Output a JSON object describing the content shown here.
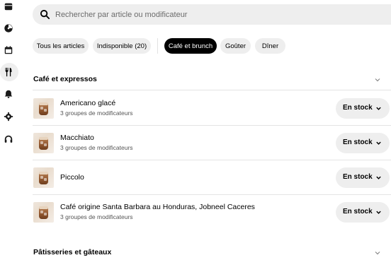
{
  "sidebar": {
    "icons": [
      "store-icon",
      "dashboard-icon",
      "calendar-icon",
      "menu-fork-knife-icon",
      "bell-icon",
      "gear-icon",
      "headset-icon"
    ],
    "active": "menu-fork-knife-icon"
  },
  "search": {
    "placeholder": "Rechercher par article ou modificateur"
  },
  "filters": [
    {
      "label": "Tous les articles",
      "active": false
    },
    {
      "label": "Indisponible (20)",
      "active": false
    },
    {
      "label": "Café et brunch",
      "active": true
    },
    {
      "label": "Goûter",
      "active": false
    },
    {
      "label": "Dîner",
      "active": false
    }
  ],
  "sections": [
    {
      "title": "Café et expressos",
      "items": [
        {
          "name": "Americano glacé",
          "modifiers": "3 groupes de modificateurs",
          "status": "En stock"
        },
        {
          "name": "Macchiato",
          "modifiers": "3 groupes de modificateurs",
          "status": "En stock"
        },
        {
          "name": "Piccolo",
          "modifiers": "",
          "status": "En stock"
        },
        {
          "name": "Café origine Santa Barbara au Honduras, Jobneel Caceres",
          "modifiers": "3 groupes de modificateurs",
          "status": "En stock"
        }
      ]
    },
    {
      "title": "Pâtisseries et gâteaux",
      "items": []
    }
  ],
  "colors": {
    "accent": "#000000",
    "chip_bg": "#eeeeee",
    "text_secondary": "#545454"
  }
}
